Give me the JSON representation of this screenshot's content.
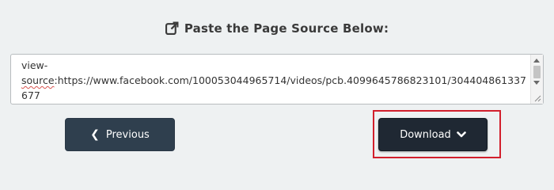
{
  "heading": {
    "icon": "external-edit-icon",
    "title": "Paste the Page Source Below:"
  },
  "source_field": {
    "value_line1": "view-",
    "value_prefix": "source",
    "value_rest": ":https://www.facebook.com/100053044965714/videos/pcb.4099645786823101/304404861337677"
  },
  "buttons": {
    "previous": {
      "label": "Previous",
      "icon": "chevron-left-icon"
    },
    "download": {
      "label": "Download",
      "icon": "chevron-down-icon"
    }
  },
  "colors": {
    "background": "#eef1f2",
    "previous_button": "#2f3f4e",
    "download_button": "#1f2833",
    "highlight": "#d21f2c"
  }
}
